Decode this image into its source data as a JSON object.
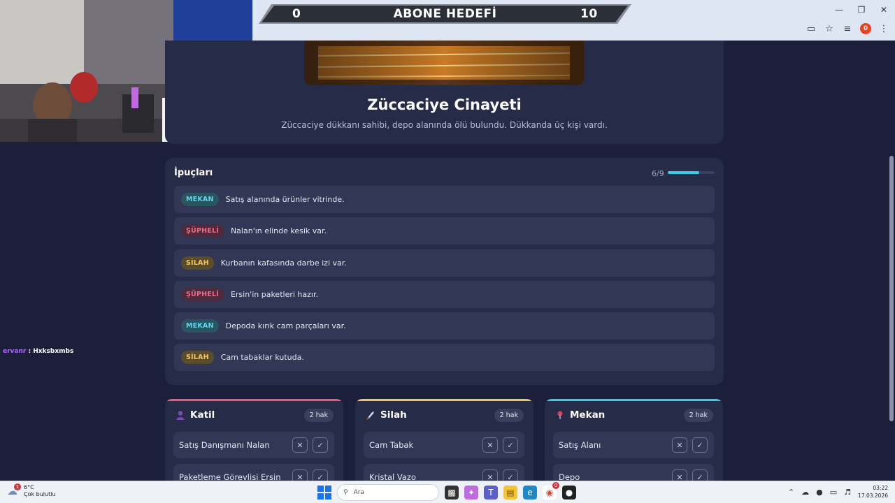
{
  "overlay": {
    "goal_current": "0",
    "goal_title": "ABONE HEDEFİ",
    "goal_target": "10"
  },
  "browser": {
    "profile_badge": "0",
    "icons": [
      "install-icon",
      "star-icon",
      "playlist-icon",
      "profile-icon",
      "menu-icon"
    ]
  },
  "case": {
    "title": "Züccaciye Cinayeti",
    "description": "Züccaciye dükkanı sahibi, depo alanında ölü bulundu. Dükkanda üç kişi vardı."
  },
  "clues": {
    "title": "İpuçları",
    "count": "6/9",
    "progress": 0.667,
    "items": [
      {
        "tag": "MEKAN",
        "type": "mekan",
        "text": "Satış alanında ürünler vitrinde."
      },
      {
        "tag": "ŞÜPHELİ",
        "type": "supheli",
        "text": "Nalan'ın elinde kesik var."
      },
      {
        "tag": "SİLAH",
        "type": "silah",
        "text": "Kurbanın kafasında darbe izi var."
      },
      {
        "tag": "ŞÜPHELİ",
        "type": "supheli",
        "text": "Ersin'in paketleri hazır."
      },
      {
        "tag": "MEKAN",
        "type": "mekan",
        "text": "Depoda kırık cam parçaları var."
      },
      {
        "tag": "SİLAH",
        "type": "silah",
        "text": "Cam tabaklar kutuda."
      }
    ]
  },
  "columns": [
    {
      "title": "Katil",
      "icon": "person-icon",
      "chance": "2 hak",
      "color": "#ef5b72",
      "options": [
        "Satış Danışmanı Nalan",
        "Paketleme Görevlisi Ersin"
      ]
    },
    {
      "title": "Silah",
      "icon": "knife-icon",
      "chance": "2 hak",
      "color": "#f2c563",
      "options": [
        "Cam Tabak",
        "Kristal Vazo"
      ]
    },
    {
      "title": "Mekan",
      "icon": "pin-icon",
      "chance": "2 hak",
      "color": "#36c9e8",
      "options": [
        "Satış Alanı",
        "Depo"
      ]
    }
  ],
  "chat": {
    "user": "ervanr",
    "message": "Hxksbxmbs"
  },
  "taskbar": {
    "weather_badge": "1",
    "temperature": "6°C",
    "condition": "Çok bulutlu",
    "search_placeholder": "Ara",
    "chrome_badge": "0",
    "time": "03:22",
    "date": "17.03.2026"
  }
}
